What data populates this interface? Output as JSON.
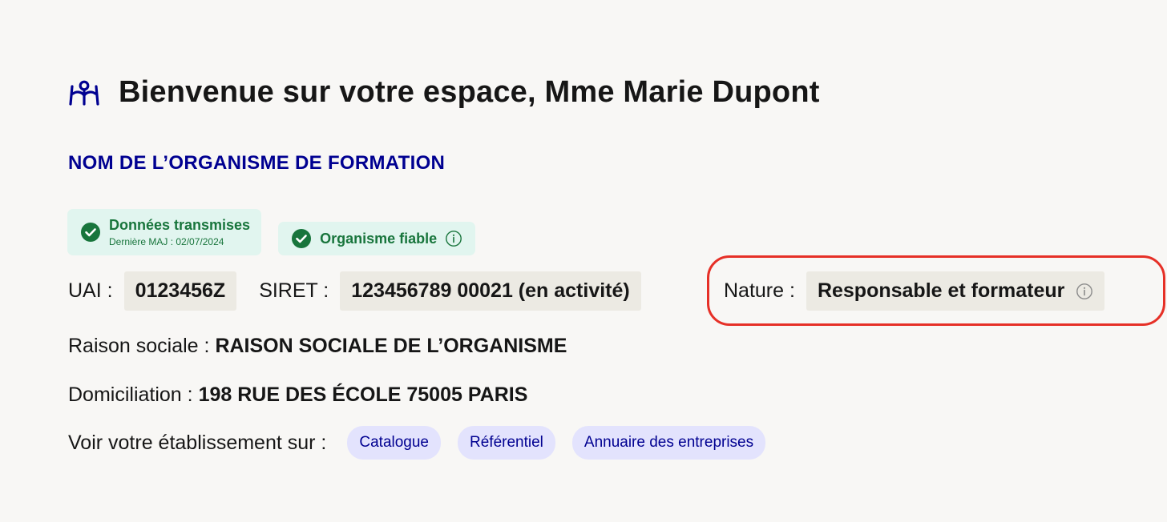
{
  "header": {
    "icon": "person-sign-icon",
    "title": "Bienvenue sur votre espace, Mme Marie Dupont"
  },
  "organisme": {
    "name": "NOM DE L’ORGANISME DE FORMATION",
    "badges": [
      {
        "label": "Données transmises",
        "sub": "Dernière MAJ : 02/07/2024"
      },
      {
        "label": "Organisme fiable"
      }
    ],
    "uai_label": "UAI :",
    "uai_value": "0123456Z",
    "siret_label": "SIRET :",
    "siret_value": "123456789 00021 (en activité)",
    "nature_label": "Nature :",
    "nature_value": "Responsable et formateur",
    "raison_label": "Raison sociale :",
    "raison_value": "RAISON SOCIALE DE L’ORGANISME",
    "domiciliation_label": "Domiciliation :",
    "domiciliation_value": "198 RUE DES ÉCOLE 75005 PARIS",
    "links_label": "Voir votre établissement sur :",
    "links": [
      "Catalogue",
      "Référentiel",
      "Annuaire des entreprises"
    ]
  },
  "colors": {
    "accent_blue": "#000091",
    "success_green": "#18753c",
    "success_bg": "#e1f5ef",
    "tag_bg": "#e3e3fd",
    "highlight_red": "#e63027",
    "value_bg": "#eceae3"
  }
}
